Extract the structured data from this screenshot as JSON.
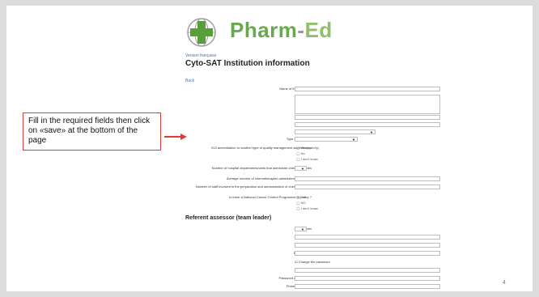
{
  "header": {
    "logo_word_pharm": "Pharm",
    "logo_word_dash": "-",
    "logo_word_ed": "Ed",
    "language_link": "Version française",
    "page_title": "Cyto-SAT Institution information",
    "back_link": "Back"
  },
  "callout": {
    "text": "Fill in the required fields then click on «save» at the bottom of the page"
  },
  "form": {
    "institution_name_label": "Name of the institution",
    "address_label": "Address",
    "postal_code_label": "Postal code",
    "city_label": "City",
    "country_label": "Country",
    "institution_type_label": "Type of institution",
    "iso_label": "ISO accreditation or another type of quality management accreditation",
    "iso_options": [
      "Yes (specify)",
      "No",
      "I don't know"
    ],
    "departments_label": "Number of hospital departments/units that administer chemotherapies",
    "avg_chemo_label": "Average number of chemotherapies administered by month",
    "staff_label": "Number of staff involved in the preparation and administration of chemotherapies",
    "ncp_label": "Is there a National Cancer Control Programme or policy ?",
    "ncp_options": [
      "Yes",
      "NO",
      "I don't know"
    ]
  },
  "referent": {
    "section_title": "Referent assessor (team leader)",
    "gender_label": "Gender",
    "last_name_label": "Last name",
    "first_name_label": "First name",
    "email_label": "Email (login)",
    "change_password_label": "Change the password",
    "password_label": "Password",
    "password_confirmation_label": "Password confirmation",
    "phone_label": "Phone (fixed line)"
  },
  "footer": {
    "page_number": "4"
  },
  "colors": {
    "logo_green": "#6aa84f",
    "callout_border": "#e53935",
    "arrow": "#e53935",
    "link": "#3b73b9"
  }
}
